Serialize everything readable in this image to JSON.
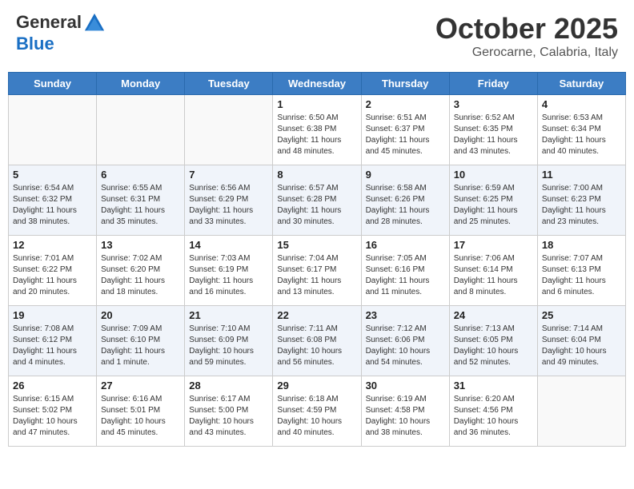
{
  "header": {
    "logo_general": "General",
    "logo_blue": "Blue",
    "month_title": "October 2025",
    "subtitle": "Gerocarne, Calabria, Italy"
  },
  "weekdays": [
    "Sunday",
    "Monday",
    "Tuesday",
    "Wednesday",
    "Thursday",
    "Friday",
    "Saturday"
  ],
  "weeks": [
    [
      {
        "day": "",
        "info": ""
      },
      {
        "day": "",
        "info": ""
      },
      {
        "day": "",
        "info": ""
      },
      {
        "day": "1",
        "info": "Sunrise: 6:50 AM\nSunset: 6:38 PM\nDaylight: 11 hours\nand 48 minutes."
      },
      {
        "day": "2",
        "info": "Sunrise: 6:51 AM\nSunset: 6:37 PM\nDaylight: 11 hours\nand 45 minutes."
      },
      {
        "day": "3",
        "info": "Sunrise: 6:52 AM\nSunset: 6:35 PM\nDaylight: 11 hours\nand 43 minutes."
      },
      {
        "day": "4",
        "info": "Sunrise: 6:53 AM\nSunset: 6:34 PM\nDaylight: 11 hours\nand 40 minutes."
      }
    ],
    [
      {
        "day": "5",
        "info": "Sunrise: 6:54 AM\nSunset: 6:32 PM\nDaylight: 11 hours\nand 38 minutes."
      },
      {
        "day": "6",
        "info": "Sunrise: 6:55 AM\nSunset: 6:31 PM\nDaylight: 11 hours\nand 35 minutes."
      },
      {
        "day": "7",
        "info": "Sunrise: 6:56 AM\nSunset: 6:29 PM\nDaylight: 11 hours\nand 33 minutes."
      },
      {
        "day": "8",
        "info": "Sunrise: 6:57 AM\nSunset: 6:28 PM\nDaylight: 11 hours\nand 30 minutes."
      },
      {
        "day": "9",
        "info": "Sunrise: 6:58 AM\nSunset: 6:26 PM\nDaylight: 11 hours\nand 28 minutes."
      },
      {
        "day": "10",
        "info": "Sunrise: 6:59 AM\nSunset: 6:25 PM\nDaylight: 11 hours\nand 25 minutes."
      },
      {
        "day": "11",
        "info": "Sunrise: 7:00 AM\nSunset: 6:23 PM\nDaylight: 11 hours\nand 23 minutes."
      }
    ],
    [
      {
        "day": "12",
        "info": "Sunrise: 7:01 AM\nSunset: 6:22 PM\nDaylight: 11 hours\nand 20 minutes."
      },
      {
        "day": "13",
        "info": "Sunrise: 7:02 AM\nSunset: 6:20 PM\nDaylight: 11 hours\nand 18 minutes."
      },
      {
        "day": "14",
        "info": "Sunrise: 7:03 AM\nSunset: 6:19 PM\nDaylight: 11 hours\nand 16 minutes."
      },
      {
        "day": "15",
        "info": "Sunrise: 7:04 AM\nSunset: 6:17 PM\nDaylight: 11 hours\nand 13 minutes."
      },
      {
        "day": "16",
        "info": "Sunrise: 7:05 AM\nSunset: 6:16 PM\nDaylight: 11 hours\nand 11 minutes."
      },
      {
        "day": "17",
        "info": "Sunrise: 7:06 AM\nSunset: 6:14 PM\nDaylight: 11 hours\nand 8 minutes."
      },
      {
        "day": "18",
        "info": "Sunrise: 7:07 AM\nSunset: 6:13 PM\nDaylight: 11 hours\nand 6 minutes."
      }
    ],
    [
      {
        "day": "19",
        "info": "Sunrise: 7:08 AM\nSunset: 6:12 PM\nDaylight: 11 hours\nand 4 minutes."
      },
      {
        "day": "20",
        "info": "Sunrise: 7:09 AM\nSunset: 6:10 PM\nDaylight: 11 hours\nand 1 minute."
      },
      {
        "day": "21",
        "info": "Sunrise: 7:10 AM\nSunset: 6:09 PM\nDaylight: 10 hours\nand 59 minutes."
      },
      {
        "day": "22",
        "info": "Sunrise: 7:11 AM\nSunset: 6:08 PM\nDaylight: 10 hours\nand 56 minutes."
      },
      {
        "day": "23",
        "info": "Sunrise: 7:12 AM\nSunset: 6:06 PM\nDaylight: 10 hours\nand 54 minutes."
      },
      {
        "day": "24",
        "info": "Sunrise: 7:13 AM\nSunset: 6:05 PM\nDaylight: 10 hours\nand 52 minutes."
      },
      {
        "day": "25",
        "info": "Sunrise: 7:14 AM\nSunset: 6:04 PM\nDaylight: 10 hours\nand 49 minutes."
      }
    ],
    [
      {
        "day": "26",
        "info": "Sunrise: 6:15 AM\nSunset: 5:02 PM\nDaylight: 10 hours\nand 47 minutes."
      },
      {
        "day": "27",
        "info": "Sunrise: 6:16 AM\nSunset: 5:01 PM\nDaylight: 10 hours\nand 45 minutes."
      },
      {
        "day": "28",
        "info": "Sunrise: 6:17 AM\nSunset: 5:00 PM\nDaylight: 10 hours\nand 43 minutes."
      },
      {
        "day": "29",
        "info": "Sunrise: 6:18 AM\nSunset: 4:59 PM\nDaylight: 10 hours\nand 40 minutes."
      },
      {
        "day": "30",
        "info": "Sunrise: 6:19 AM\nSunset: 4:58 PM\nDaylight: 10 hours\nand 38 minutes."
      },
      {
        "day": "31",
        "info": "Sunrise: 6:20 AM\nSunset: 4:56 PM\nDaylight: 10 hours\nand 36 minutes."
      },
      {
        "day": "",
        "info": ""
      }
    ]
  ]
}
